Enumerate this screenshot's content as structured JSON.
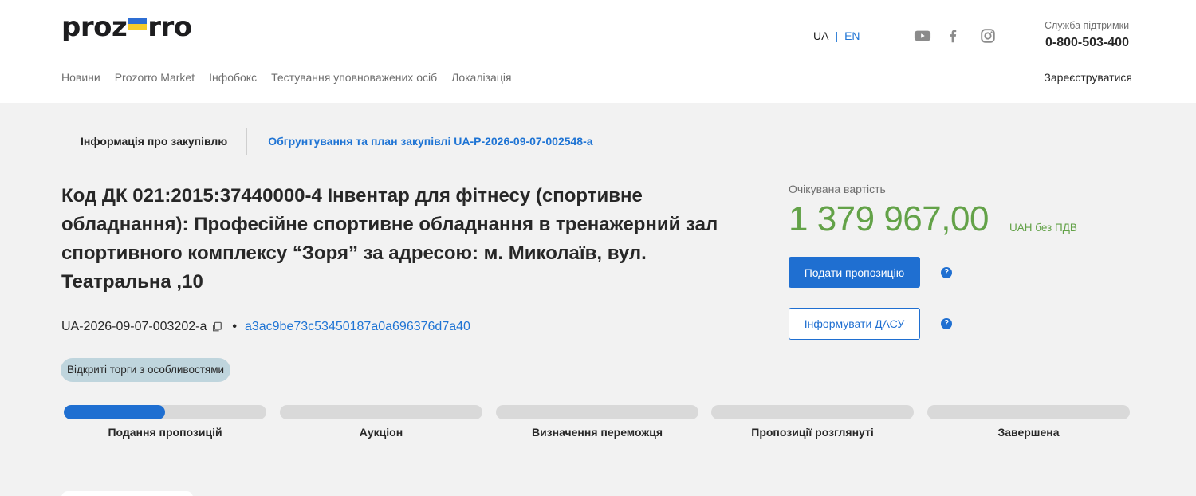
{
  "header": {
    "logo_left": "proz",
    "logo_right": "rro",
    "languages": {
      "ua": "UA",
      "en": "EN"
    },
    "social": [
      "youtube-icon",
      "facebook-icon",
      "instagram-icon"
    ],
    "support_label": "Служба підтримки",
    "support_phone": "0-800-503-400",
    "nav": [
      "Новини",
      "Prozorro Market",
      "Інфобокс",
      "Тестування уповноважених осіб",
      "Локалізація"
    ],
    "register": "Зареєструватися"
  },
  "tabs": {
    "active": "Інформація про закупівлю",
    "link": "Обгрунтування та план закупівлі UA-P-2026-09-07-002548-a"
  },
  "tender": {
    "title": "Код ДК 021:2015:37440000-4 Інвентар для фітнесу (спортивне обладнання): Професійне спортивне обладнання в тренажерний зал спортивного комплексу “Зоря” за адресою: м. Миколаїв, вул. Театральна ,10",
    "id": "UA-2026-09-07-003202-a",
    "hash": "a3ac9be73c53450187a0a696376d7a40",
    "badge": "Відкриті торги з особливостями"
  },
  "price": {
    "label": "Очікувана вартість",
    "amount": "1 379 967,00",
    "currency": "UAH без ПДВ"
  },
  "actions": {
    "submit": "Подати пропозицію",
    "inform": "Інформувати ДАСУ",
    "help": "?"
  },
  "colors": {
    "accent": "#1f6fd1",
    "price": "#63a248",
    "badge": "#bfd5dd"
  },
  "stages": [
    {
      "label": "Подання пропозицій",
      "progress": 0.5
    },
    {
      "label": "Аукціон",
      "progress": 0
    },
    {
      "label": "Визначення переможця",
      "progress": 0
    },
    {
      "label": "Пропозиції розглянуті",
      "progress": 0
    },
    {
      "label": "Завершена",
      "progress": 0
    }
  ]
}
